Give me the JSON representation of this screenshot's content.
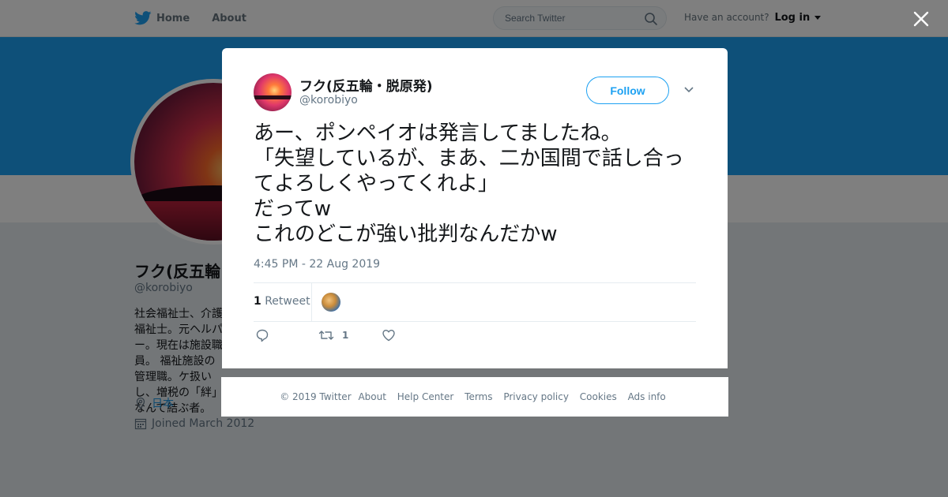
{
  "nav": {
    "home_label": "Home",
    "about_label": "About",
    "search_placeholder": "Search Twitter",
    "have_account": "Have an account?",
    "login_label": "Log in"
  },
  "profile": {
    "name": "フク(反五輪",
    "handle": "@korobiyo",
    "bio": "社会福祉士、介護福祉士。元ヘルパー。現在は施設職員。 福祉施設の管理職。ケ扱いし、増税の「絆」なんて結ぶ者。",
    "location": "日本",
    "joined": "Joined March 2012"
  },
  "tweet": {
    "author_name": "フク(反五輪・脱原発)",
    "author_handle": "@korobiyo",
    "follow_label": "Follow",
    "text": "あー、ポンペイオは発言してましたね。\n「失望しているが、まあ、二か国間で話し合ってよろしくやってくれよ」\nだってw\nこれのどこが強い批判なんだかw",
    "timestamp": "4:45 PM - 22 Aug 2019",
    "retweet_count": "1",
    "retweet_label": "Retweet",
    "action_retweet_count": "1"
  },
  "footer": {
    "copyright": "© 2019 Twitter",
    "links": [
      "About",
      "Help Center",
      "Terms",
      "Privacy policy",
      "Cookies",
      "Ads info"
    ]
  },
  "colors": {
    "accent": "#1da1f2",
    "overlay": "rgba(0,0,0,0.5)"
  }
}
